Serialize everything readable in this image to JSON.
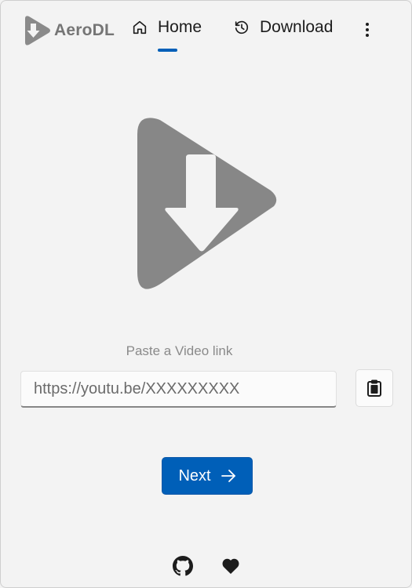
{
  "app": {
    "name": "AeroDL",
    "accent_color": "#005fb8"
  },
  "nav": {
    "items": [
      {
        "label": "Home",
        "icon": "home-icon",
        "selected": true
      },
      {
        "label": "Download",
        "icon": "history-icon",
        "selected": false
      }
    ],
    "more_icon": "more-vertical-icon"
  },
  "main": {
    "hero_icon": "play-download-icon",
    "paste_label": "Paste a Video link",
    "url_input": {
      "value": "",
      "placeholder": "https://youtu.be/XXXXXXXXX"
    },
    "paste_button_icon": "clipboard-icon",
    "next_button": {
      "label": "Next",
      "icon": "arrow-right-icon"
    }
  },
  "footer": {
    "icons": [
      "github-icon",
      "heart-icon"
    ]
  }
}
